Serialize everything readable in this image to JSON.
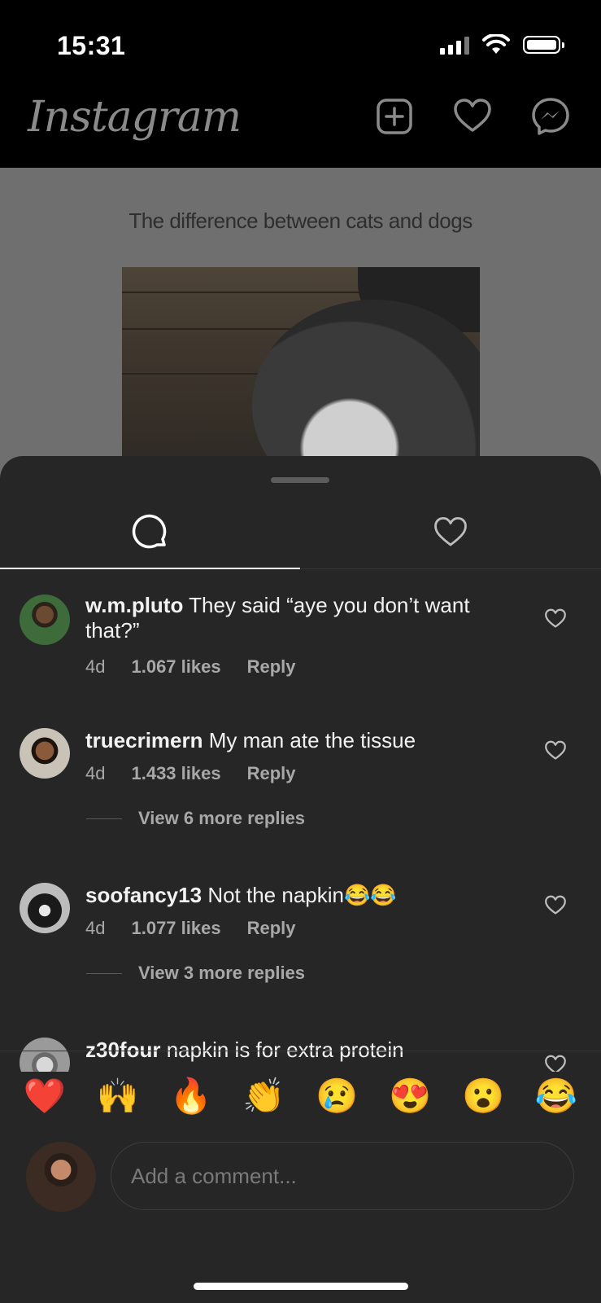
{
  "status_bar": {
    "time": "15:31"
  },
  "header": {
    "logo": "Instagram",
    "icons": [
      "add-post-icon",
      "heart-icon",
      "messenger-icon"
    ]
  },
  "post": {
    "caption": "The difference between cats and dogs"
  },
  "sheet": {
    "tabs": [
      {
        "name": "comments",
        "icon": "comment-bubble-icon",
        "active": true
      },
      {
        "name": "likes",
        "icon": "heart-icon",
        "active": false
      }
    ]
  },
  "comments": [
    {
      "user": "w.m.pluto",
      "text": "They said “aye you don’t want that?”",
      "age": "4d",
      "likes": "1.067 likes",
      "reply": "Reply"
    },
    {
      "user": "truecrimern",
      "text": "My man ate the tissue",
      "age": "4d",
      "likes": "1.433 likes",
      "reply": "Reply",
      "view_more": "View 6 more replies"
    },
    {
      "user": "soofancy13",
      "text": "Not the napkin😂😂",
      "age": "4d",
      "likes": "1.077 likes",
      "reply": "Reply",
      "view_more": "View 3 more replies"
    },
    {
      "user": "z30four",
      "text": "napkin is for extra protein"
    }
  ],
  "reactions": [
    "❤️",
    "🙌",
    "🔥",
    "👏",
    "😢",
    "😍",
    "😮",
    "😂"
  ],
  "composer": {
    "placeholder": "Add a comment..."
  }
}
